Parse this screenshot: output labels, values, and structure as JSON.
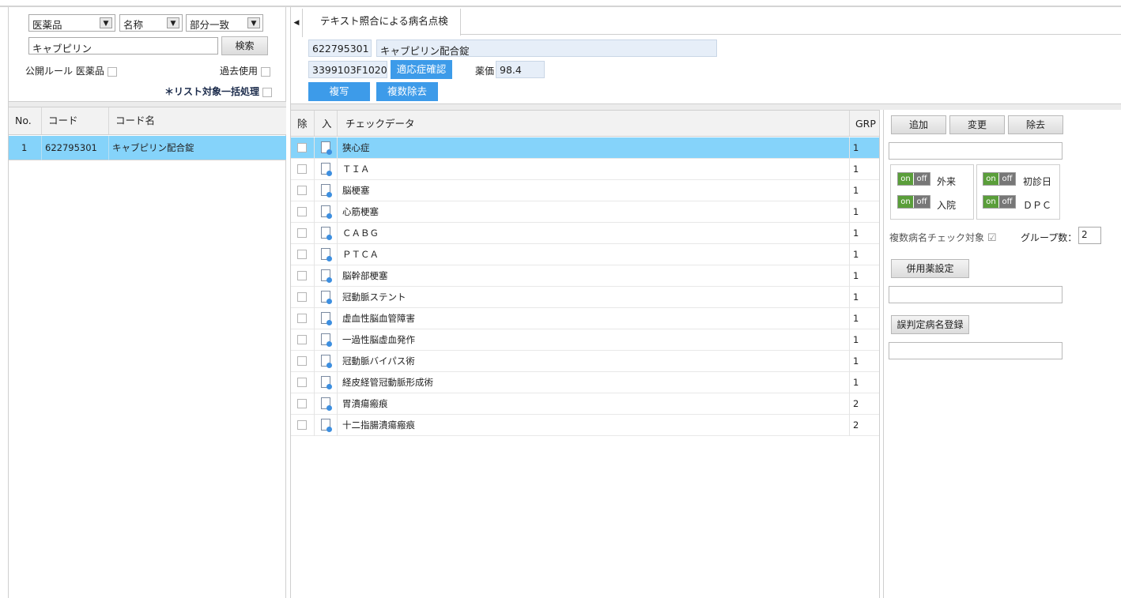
{
  "search": {
    "type_select": "医薬品",
    "field_select": "名称",
    "match_select": "部分一致",
    "keyword": "キャブピリン",
    "search_label": "検索",
    "public_rule_label": "公開ルール 医薬品",
    "past_use_label": "過去使用",
    "bulk_label": "＊リスト対象一括処理"
  },
  "left_grid": {
    "headers": [
      "No.",
      "コード",
      "コード名"
    ],
    "rows": [
      {
        "no": "1",
        "code": "622795301",
        "name": "キャブピリン配合錠"
      }
    ]
  },
  "tab": {
    "label": "テキスト照合による病名点検"
  },
  "detail": {
    "code": "622795301",
    "name": "キャブピリン配合錠",
    "yj_code": "3399103F1020",
    "indication_button": "適応症確認",
    "price_label": "薬価",
    "price_value": "98.4",
    "copy_button": "複写",
    "multi_remove_button": "複数除去"
  },
  "check_grid": {
    "headers": {
      "remove": "除",
      "input": "入",
      "check_data": "チェックデータ",
      "grp": "GRP"
    },
    "rows": [
      {
        "name": "狭心症",
        "grp": "1"
      },
      {
        "name": "ＴＩＡ",
        "grp": "1"
      },
      {
        "name": "脳梗塞",
        "grp": "1"
      },
      {
        "name": "心筋梗塞",
        "grp": "1"
      },
      {
        "name": "ＣＡＢＧ",
        "grp": "1"
      },
      {
        "name": "ＰＴＣＡ",
        "grp": "1"
      },
      {
        "name": "脳幹部梗塞",
        "grp": "1"
      },
      {
        "name": "冠動脈ステント",
        "grp": "1"
      },
      {
        "name": "虚血性脳血管障害",
        "grp": "1"
      },
      {
        "name": "一過性脳虚血発作",
        "grp": "1"
      },
      {
        "name": "冠動脈バイパス術",
        "grp": "1"
      },
      {
        "name": "経皮経管冠動脈形成術",
        "grp": "1"
      },
      {
        "name": "胃潰瘍瘢痕",
        "grp": "2"
      },
      {
        "name": "十二指腸潰瘍瘢痕",
        "grp": "2"
      }
    ]
  },
  "right": {
    "add_button": "追加",
    "change_button": "変更",
    "remove_button": "除去",
    "toggle_on": "on",
    "toggle_off": "off",
    "outpatient": "外来",
    "inpatient": "入院",
    "first_visit": "初診日",
    "dpc": "ＤＰＣ",
    "multi_check_label": "複数病名チェック対象",
    "group_count_label": "グループ数：",
    "group_count_value": "2",
    "concomitant_button": "併用薬設定",
    "misjudge_button": "誤判定病名登録"
  },
  "colors": {
    "accent": "#3d9be9",
    "selected_row": "#85d3fa",
    "field_bg": "#e6eef8"
  }
}
